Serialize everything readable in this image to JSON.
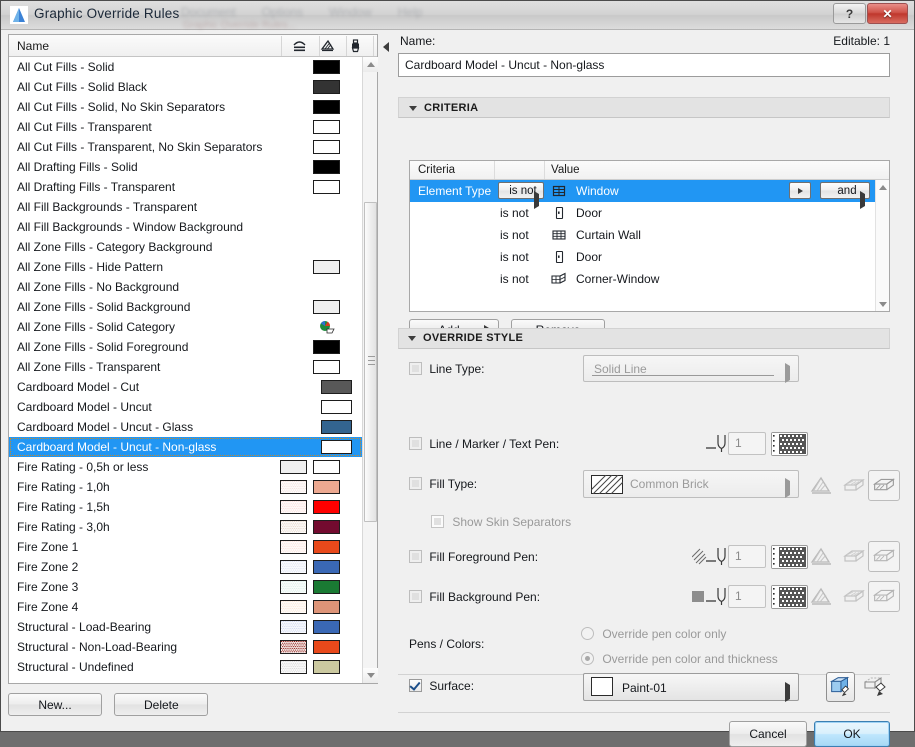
{
  "window": {
    "title": "Graphic Override Rules",
    "app_icon": "archicad-logo-icon",
    "help_label": "?",
    "close_label": "✕",
    "ghost_menu": [
      "Document",
      "Options",
      "Window",
      "Help"
    ],
    "ghost_submenu": "Graphic Override Rules..."
  },
  "left_panel": {
    "header": {
      "name_column": "Name",
      "icons": [
        "cut-fill-icon",
        "drafting-fill-icon",
        "surface-paint-icon"
      ]
    },
    "rows": [
      {
        "label": "All Cut Fills - Solid",
        "swatches": [
          {
            "pos": "solo",
            "fill": "#000000"
          }
        ]
      },
      {
        "label": "All Cut Fills - Solid Black",
        "swatches": [
          {
            "pos": "solo",
            "fill": "#333333"
          }
        ]
      },
      {
        "label": "All Cut Fills - Solid, No Skin Separators",
        "swatches": [
          {
            "pos": "solo",
            "fill": "#000000"
          }
        ]
      },
      {
        "label": "All Cut Fills - Transparent",
        "swatches": [
          {
            "pos": "solo",
            "fill": "#ffffff"
          }
        ]
      },
      {
        "label": "All Cut Fills - Transparent, No Skin Separators",
        "swatches": [
          {
            "pos": "solo",
            "fill": "#ffffff"
          }
        ]
      },
      {
        "label": "All Drafting Fills - Solid",
        "swatches": [
          {
            "pos": "solo",
            "fill": "#000000"
          }
        ]
      },
      {
        "label": "All Drafting Fills - Transparent",
        "swatches": [
          {
            "pos": "solo",
            "fill": "#ffffff"
          }
        ]
      },
      {
        "label": "All Fill Backgrounds - Transparent",
        "swatches": []
      },
      {
        "label": "All Fill Backgrounds - Window Background",
        "swatches": []
      },
      {
        "label": "All Zone Fills - Category Background",
        "swatches": []
      },
      {
        "label": "All Zone Fills - Hide Pattern",
        "swatches": [
          {
            "pos": "solo",
            "fill": "#efefef"
          }
        ]
      },
      {
        "label": "All Zone Fills - No Background",
        "swatches": []
      },
      {
        "label": "All Zone Fills - Solid Background",
        "swatches": [
          {
            "pos": "solo",
            "fill": "#efefef"
          }
        ]
      },
      {
        "label": "All Zone Fills - Solid Category",
        "swatches": [
          {
            "pos": "icon",
            "fill": "category-icon"
          }
        ]
      },
      {
        "label": "All Zone Fills - Solid Foreground",
        "swatches": [
          {
            "pos": "solo",
            "fill": "#000000"
          }
        ]
      },
      {
        "label": "All Zone Fills - Transparent",
        "swatches": [
          {
            "pos": "solo",
            "fill": "#ffffff"
          }
        ]
      },
      {
        "label": "Cardboard Model - Cut",
        "swatches": [
          {
            "pos": "wide",
            "fill": "#585858"
          }
        ]
      },
      {
        "label": "Cardboard Model - Uncut",
        "swatches": [
          {
            "pos": "wide",
            "fill": "#ffffff"
          }
        ]
      },
      {
        "label": "Cardboard Model - Uncut - Glass",
        "swatches": [
          {
            "pos": "wide",
            "fill": "#33648f"
          }
        ]
      },
      {
        "label": "Cardboard Model - Uncut - Non-glass",
        "selected": true,
        "swatches": [
          {
            "pos": "wide",
            "fill": "#ffffff"
          }
        ]
      },
      {
        "label": "Fire Rating - 0,5h or less",
        "swatches": [
          {
            "pos": "a",
            "fill": "#efefef"
          },
          {
            "pos": "b",
            "fill": "#ffffff"
          }
        ]
      },
      {
        "label": "Fire Rating - 1,0h",
        "swatches": [
          {
            "pos": "a",
            "fill": "#f3e0dc",
            "pattern": "dots"
          },
          {
            "pos": "b",
            "fill": "#eda991"
          }
        ]
      },
      {
        "label": "Fire Rating - 1,5h",
        "swatches": [
          {
            "pos": "a",
            "fill": "#fbdcd8",
            "pattern": "dots"
          },
          {
            "pos": "b",
            "fill": "#ff0000"
          }
        ]
      },
      {
        "label": "Fire Rating - 3,0h",
        "swatches": [
          {
            "pos": "a",
            "fill": "#e6d6c9",
            "pattern": "dots"
          },
          {
            "pos": "b",
            "fill": "#730b2f"
          }
        ]
      },
      {
        "label": "Fire Zone 1",
        "swatches": [
          {
            "pos": "a",
            "fill": "#fbe0d8",
            "pattern": "dots"
          },
          {
            "pos": "b",
            "fill": "#e8491b"
          }
        ]
      },
      {
        "label": "Fire Zone 2",
        "swatches": [
          {
            "pos": "a",
            "fill": "#dde2f2",
            "pattern": "dots"
          },
          {
            "pos": "b",
            "fill": "#3a68b5"
          }
        ]
      },
      {
        "label": "Fire Zone 3",
        "swatches": [
          {
            "pos": "a",
            "fill": "#d8eee6",
            "pattern": "dots"
          },
          {
            "pos": "b",
            "fill": "#1a7a33"
          }
        ]
      },
      {
        "label": "Fire Zone 4",
        "swatches": [
          {
            "pos": "a",
            "fill": "#fbe6d4",
            "pattern": "dots"
          },
          {
            "pos": "b",
            "fill": "#dd9478"
          }
        ]
      },
      {
        "label": "Structural - Load-Bearing",
        "swatches": [
          {
            "pos": "a",
            "fill": "#cdd6ef",
            "pattern": "dots"
          },
          {
            "pos": "b",
            "fill": "#3a68b5"
          }
        ]
      },
      {
        "label": "Structural - Non-Load-Bearing",
        "swatches": [
          {
            "pos": "a",
            "fill": "#8e1a11",
            "pattern": "dots"
          },
          {
            "pos": "b",
            "fill": "#e8491b"
          }
        ]
      },
      {
        "label": "Structural - Undefined",
        "swatches": [
          {
            "pos": "a",
            "fill": "#d6d6d6",
            "pattern": "dots"
          },
          {
            "pos": "b",
            "fill": "#cbc9a0"
          }
        ]
      }
    ],
    "new_button": "New...",
    "delete_button": "Delete"
  },
  "right_panel": {
    "name_label": "Name:",
    "editable_label": "Editable: 1",
    "name_value": "Cardboard Model - Uncut - Non-glass",
    "criteria_section": {
      "title": "CRITERIA",
      "columns": {
        "criteria": "Criteria",
        "value": "Value"
      },
      "rows": [
        {
          "criteria": "Element Type",
          "operator": "is not",
          "value": "Window",
          "icon": "window-icon",
          "conjunction": "and",
          "selected": true
        },
        {
          "criteria": "",
          "operator": "is not",
          "value": "Door",
          "icon": "door-icon",
          "selected": false
        },
        {
          "criteria": "",
          "operator": "is not",
          "value": "Curtain Wall",
          "icon": "curtain-wall-icon",
          "selected": false
        },
        {
          "criteria": "",
          "operator": "is not",
          "value": "Door",
          "icon": "door-icon",
          "selected": false
        },
        {
          "criteria": "",
          "operator": "is not",
          "value": "Corner-Window",
          "icon": "corner-window-icon",
          "selected": false
        }
      ],
      "add_button": "Add...",
      "remove_button": "Remove"
    },
    "override_section": {
      "title": "OVERRIDE STYLE",
      "line_type": {
        "label": "Line Type:",
        "checked": false,
        "value": "Solid Line"
      },
      "line_pen": {
        "label": "Line / Marker / Text Pen:",
        "checked": false,
        "pen_number": "1"
      },
      "fill_type": {
        "label": "Fill Type:",
        "checked": false,
        "value": "Common Brick"
      },
      "show_skin_separators": {
        "label": "Show Skin Separators",
        "checked": false
      },
      "fill_fg_pen": {
        "label": "Fill Foreground Pen:",
        "checked": false,
        "pen_number": "1"
      },
      "fill_bg_pen": {
        "label": "Fill Background Pen:",
        "checked": false,
        "pen_number": "1"
      },
      "pens_colors": {
        "label": "Pens / Colors:",
        "option_color_only": "Override pen color only",
        "option_color_thickness": "Override pen color and thickness",
        "selected": "Override pen color and thickness"
      },
      "surface": {
        "label": "Surface:",
        "checked": true,
        "value": "Paint-01",
        "swatch": "#ffffff"
      }
    },
    "cancel_button": "Cancel",
    "ok_button": "OK"
  },
  "colors": {
    "selection": "#2196f3",
    "window_bg": "#f0f0f0",
    "accent_primary": "#bee6fd"
  }
}
